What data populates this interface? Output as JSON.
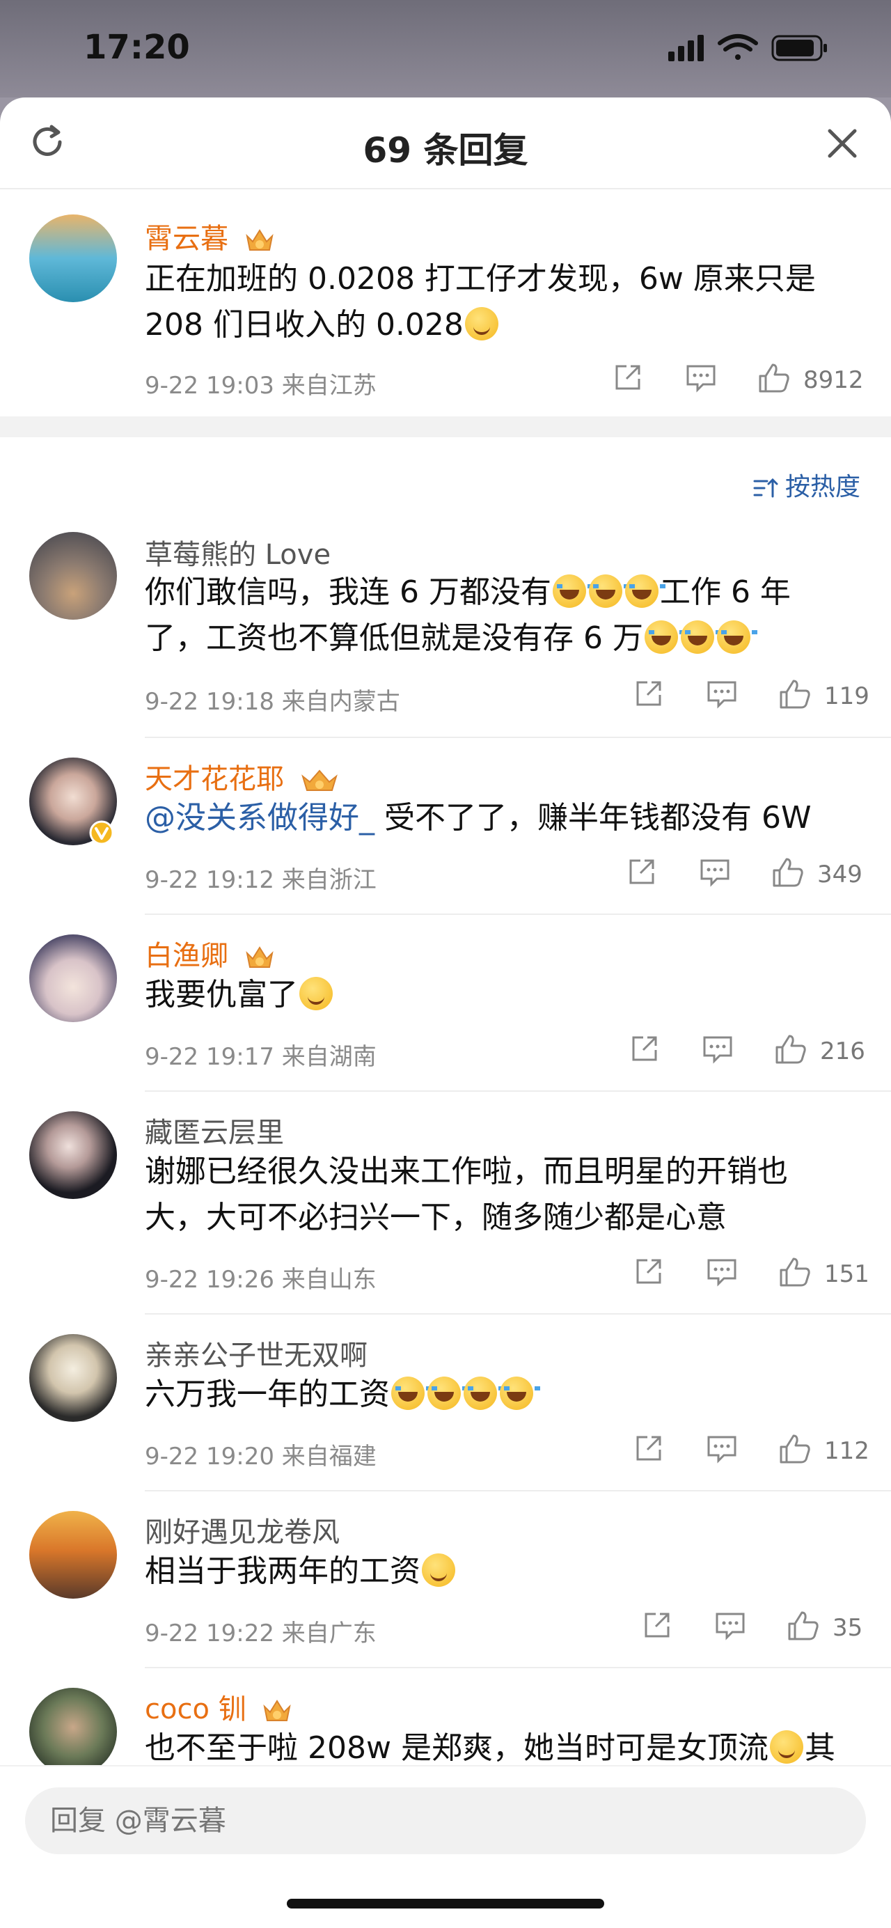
{
  "status": {
    "time": "17:20"
  },
  "header": {
    "title": "69 条回复"
  },
  "main_comment": {
    "user": "霄云暮",
    "text_line1": "正在加班的 0.0208 打工仔才发现，6w 原来只是",
    "text_line2": "208 们日收入的 0.028",
    "meta": "9-22 19:03  来自江苏",
    "likes": "8912"
  },
  "sort": {
    "label": "按热度"
  },
  "comments": [
    {
      "user": "草莓熊的 Love",
      "line1": "你们敢信吗，我连 6 万都没有",
      "line1b": "工作 6 年",
      "line2": "了，工资也不算低但就是没有存 6 万",
      "meta": "9-22 19:18  来自内蒙古",
      "likes": "119"
    },
    {
      "user": "天才花花耶",
      "mention": "@没关系做得好_",
      "line1": " 受不了了，赚半年钱都没有 6W",
      "meta": "9-22 19:12  来自浙江",
      "likes": "349"
    },
    {
      "user": "白渔卿",
      "line1": "我要仇富了",
      "meta": "9-22 19:17  来自湖南",
      "likes": "216"
    },
    {
      "user": "藏匿云层里",
      "line1": "谢娜已经很久没出来工作啦，而且明星的开销也",
      "line2": "大，大可不必扫兴一下，随多随少都是心意",
      "meta": "9-22 19:26  来自山东",
      "likes": "151"
    },
    {
      "user": "亲亲公子世无双啊",
      "line1": "六万我一年的工资",
      "meta": "9-22 19:20  来自福建",
      "likes": "112"
    },
    {
      "user": "刚好遇见龙卷风",
      "line1": "相当于我两年的工资",
      "meta": "9-22 19:22  来自广东",
      "likes": "35"
    },
    {
      "user": "coco 钏",
      "line1": "也不至于啦 208w 是郑爽，她当时可是女顶流",
      "line1b": "其"
    }
  ],
  "reply": {
    "placeholder": "回复 @霄云暮"
  },
  "colors": {
    "vip_name": "#e86f12",
    "link": "#2b5fa6",
    "meta": "#8a8a8a"
  }
}
